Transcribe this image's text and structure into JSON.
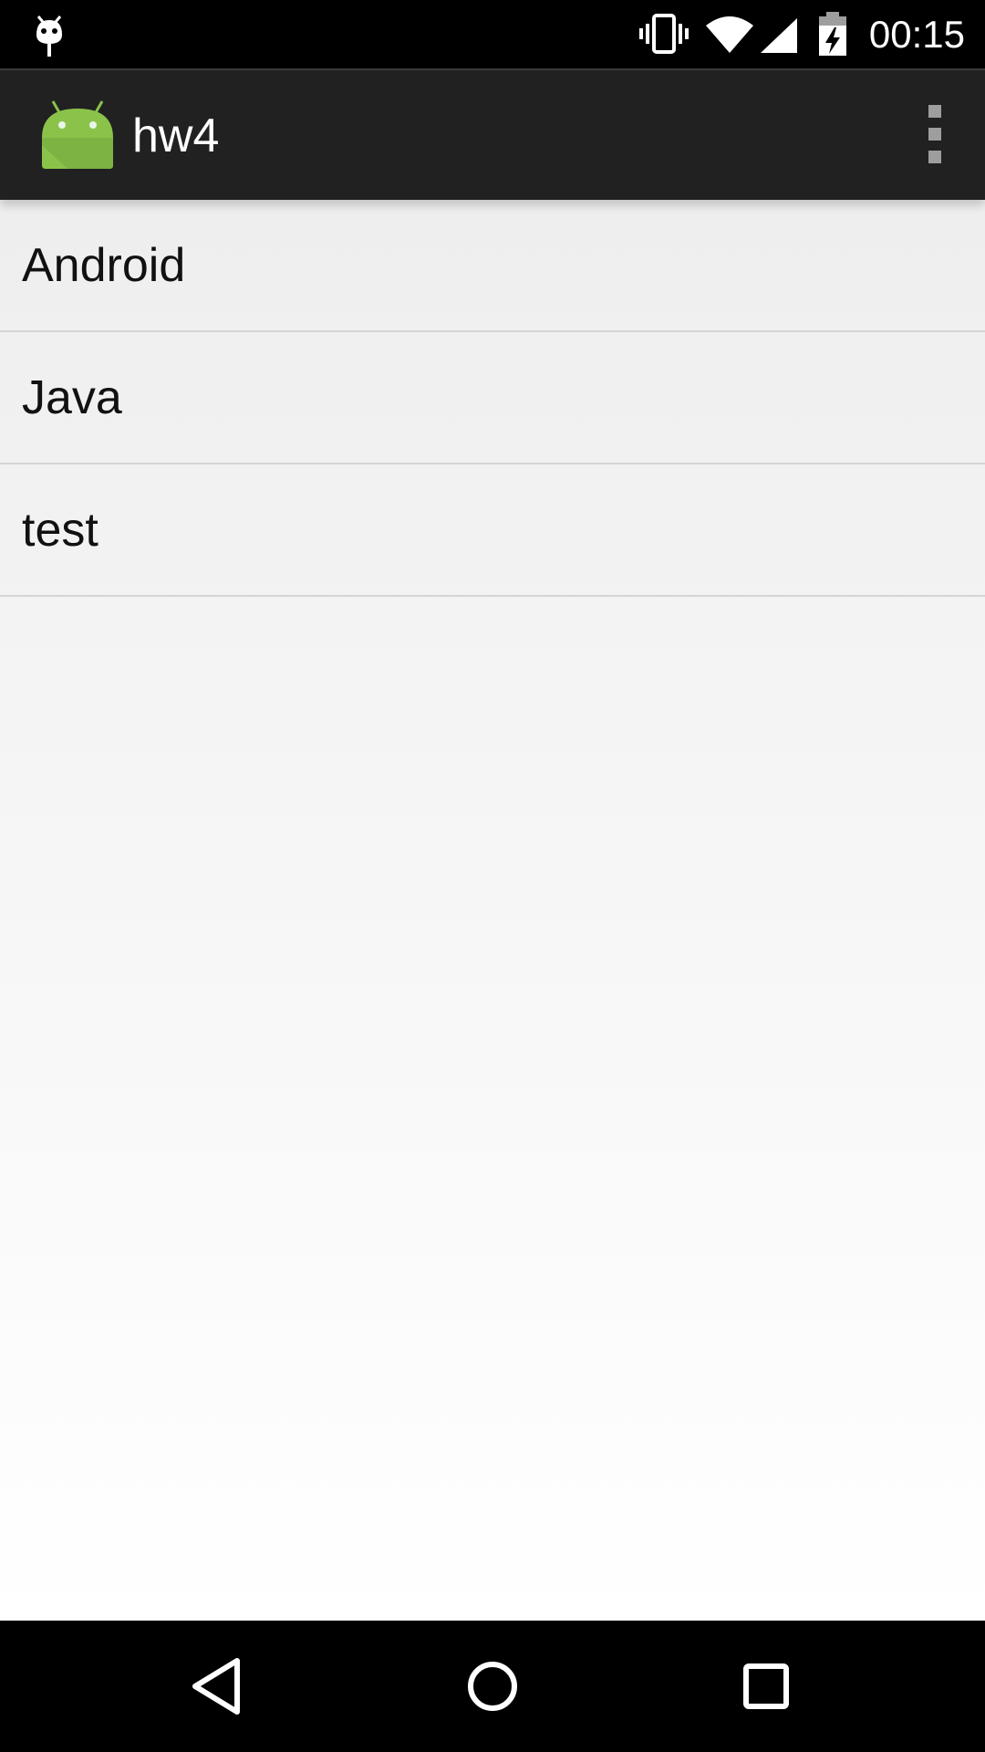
{
  "status_bar": {
    "time": "00:15",
    "icons": [
      "debug-icon",
      "vibrate-icon",
      "wifi-icon",
      "signal-icon",
      "battery-charging-icon"
    ]
  },
  "action_bar": {
    "title": "hw4",
    "app_icon": "android-icon",
    "menu_icon": "overflow-menu-icon",
    "background_color": "#212121"
  },
  "list": {
    "items": [
      {
        "label": "Android"
      },
      {
        "label": "Java"
      },
      {
        "label": "test"
      }
    ]
  },
  "nav_bar": {
    "buttons": [
      "back-icon",
      "home-icon",
      "recents-icon"
    ]
  },
  "colors": {
    "android_green": "#8bc34a",
    "status_bar": "#000000",
    "list_divider": "#d4d4d4"
  }
}
